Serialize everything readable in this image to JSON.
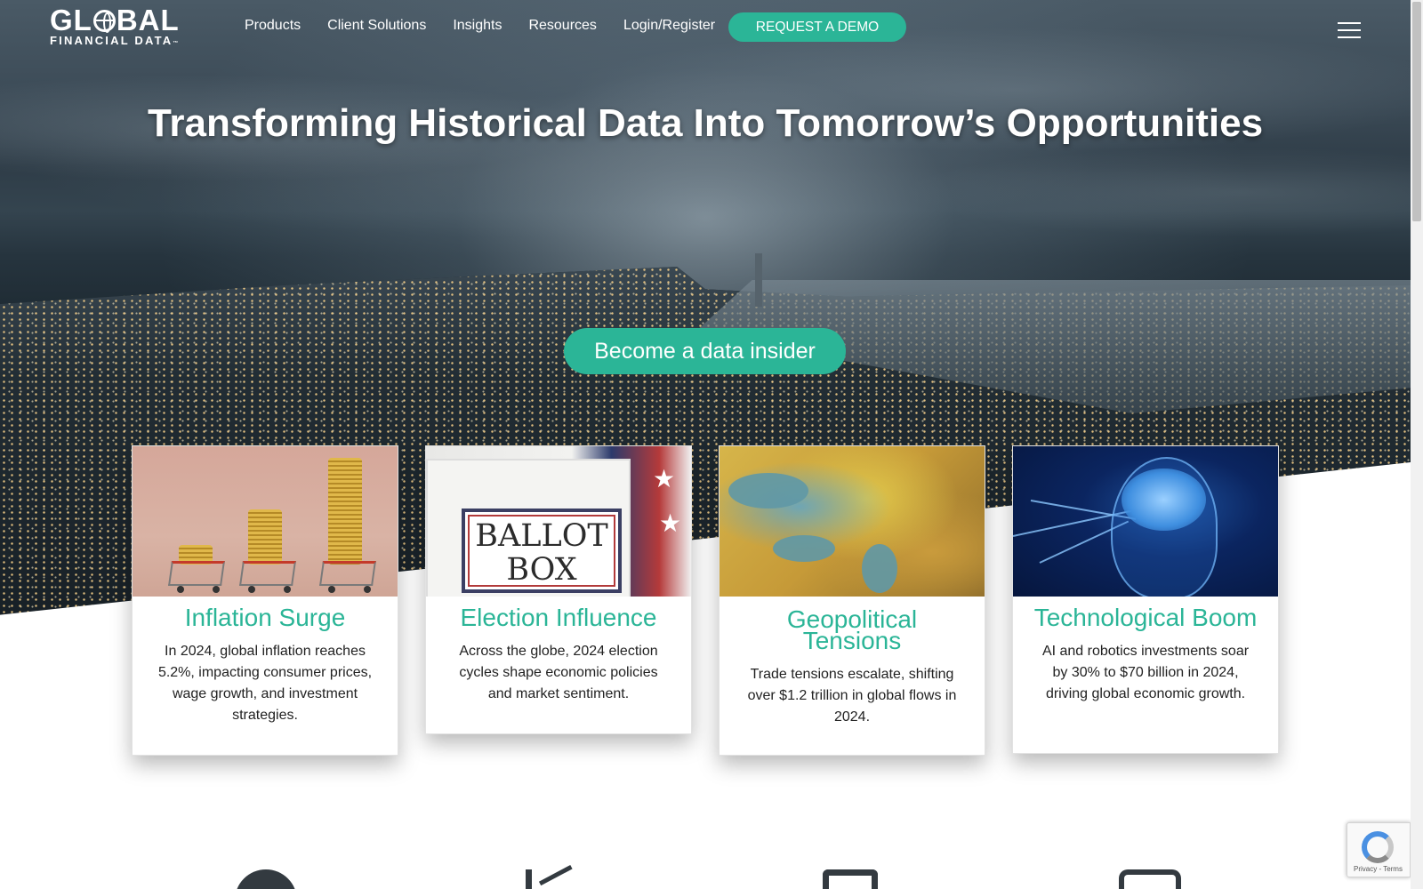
{
  "logo": {
    "top": "GL",
    "top_end": "BAL",
    "bottom": "FINANCIAL DATA",
    "tm": "™"
  },
  "nav": {
    "items": [
      "Products",
      "Client Solutions",
      "Insights",
      "Resources",
      "Login/Register"
    ],
    "demo_label": "REQUEST A DEMO"
  },
  "hero": {
    "title": "Transforming Historical Data Into Tomorrow’s Opportunities",
    "cta_label": "Become a data insider"
  },
  "cards": [
    {
      "title": "Inflation Surge",
      "text": "In 2024, global inflation reaches 5.2%, impacting consumer prices, wage growth, and investment strategies.",
      "image": "coins-in-shopping-carts"
    },
    {
      "title": "Election Influence",
      "text": "Across the globe, 2024 election cycles shape economic policies and market sentiment.",
      "image": "ballot-box",
      "image_text_1": "BALLOT",
      "image_text_2": "BOX"
    },
    {
      "title": "Geopolitical Tensions",
      "text": "Trade tensions escalate, shifting over $1.2 trillion in global flows in 2024.",
      "image": "globe-map"
    },
    {
      "title": "Technological Boom",
      "text": "AI and robotics investments soar by 30% to $70 billion in 2024, driving global economic growth.",
      "image": "digital-head-brain"
    }
  ],
  "bottom_icons": [
    "globe-icon",
    "chart-icon",
    "shield-icon",
    "book-icon"
  ],
  "recaptcha": {
    "text": "Privacy - Terms"
  },
  "colors": {
    "accent": "#2bb597",
    "text": "#222222"
  }
}
